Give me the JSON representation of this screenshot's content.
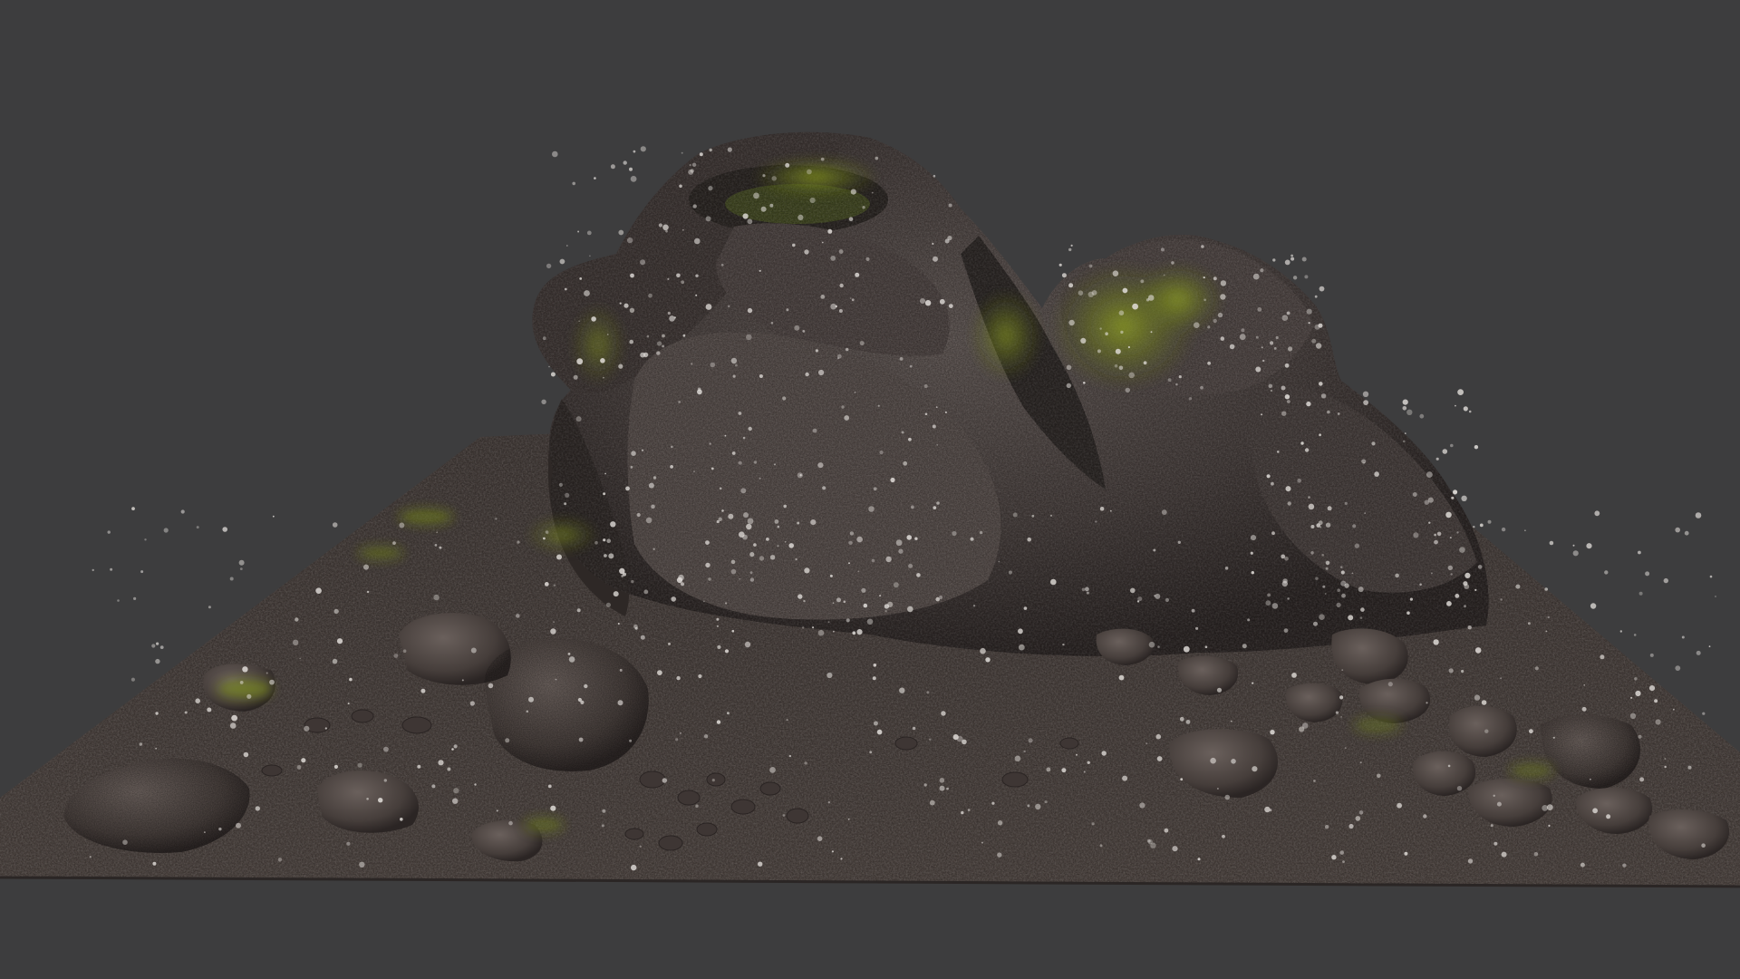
{
  "scene": {
    "subject": "rock-formation-3d-model",
    "colors": {
      "background": "#3d3d3e",
      "rock_dark": "#332d2c",
      "rock_mid": "#4d4543",
      "rock_light": "#6b615d",
      "ground": "#3c3533",
      "ground_light": "#5a504c",
      "moss": "#6c7a1e",
      "moss_bright": "#8c9c25",
      "lichen": "#e4e0dc"
    }
  }
}
